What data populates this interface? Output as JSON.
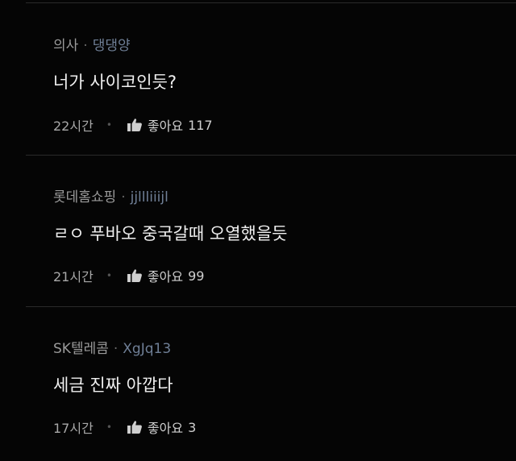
{
  "comments": [
    {
      "author": "의사",
      "handle": "댕댕양",
      "separator": "·",
      "text": "너가 사이코인듯?",
      "time": "22시간",
      "like_label": "좋아요",
      "like_count": "117",
      "like_icon": "thumbs-up-icon"
    },
    {
      "author": "롯데홈쇼핑",
      "handle": "jjllliiijl",
      "separator": "·",
      "text": "ㄹㅇ 푸바오 중국갈때 오열했을듯",
      "time": "21시간",
      "like_label": "좋아요",
      "like_count": "99",
      "like_icon": "thumbs-up-icon"
    },
    {
      "author": "SK텔레콤",
      "handle": "XgJq13",
      "separator": "·",
      "text": "세금 진짜 아깝다",
      "time": "17시간",
      "like_label": "좋아요",
      "like_count": "3",
      "like_icon": "thumbs-up-icon"
    }
  ],
  "colors": {
    "background": "#050505",
    "divider": "#2a2a2a",
    "author": "#9a9a9a",
    "handle": "#6f7f96",
    "text": "#f0f0f0"
  }
}
